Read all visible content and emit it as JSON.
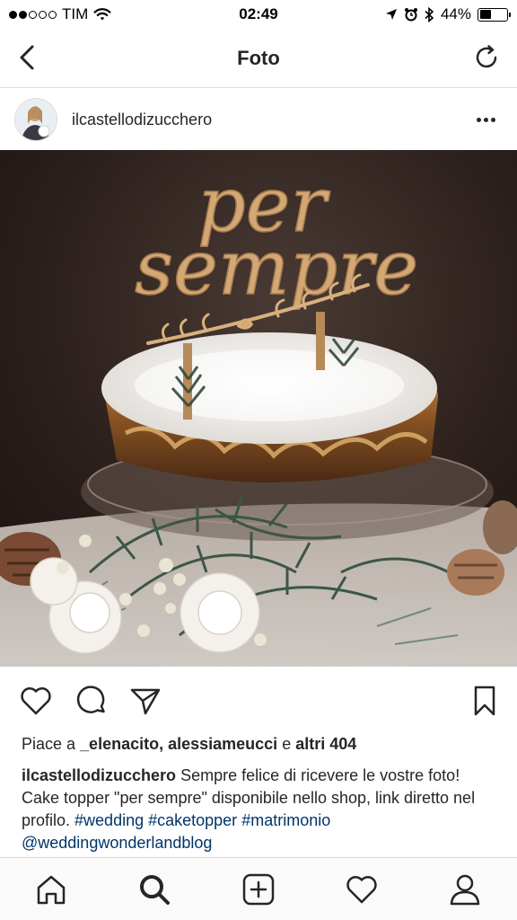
{
  "status_bar": {
    "carrier": "TIM",
    "time": "02:49",
    "battery_percent_label": "44%",
    "battery_level": 0.44,
    "signal_filled": 2,
    "signal_total": 5,
    "icons": [
      "wifi-icon",
      "location-arrow-icon",
      "alarm-clock-icon",
      "bluetooth-icon",
      "battery-icon"
    ]
  },
  "nav": {
    "title": "Foto",
    "icons": [
      "back-chevron-icon",
      "refresh-icon"
    ]
  },
  "post": {
    "username": "ilcastellodizucchero",
    "photo_text": "per sempre",
    "likes": {
      "prefix": "Piace a ",
      "users": "_elenacito, alessiameucci",
      "conjunction": " e ",
      "others": "altri 404"
    },
    "caption": {
      "author": "ilcastellodizucchero",
      "text": " Sempre felice di ricevere le vostre foto! Cake topper \"per sempre\" disponibile nello shop, link diretto nel profilo. ",
      "tags": [
        "#wedding",
        "#caketopper",
        "#matrimonio",
        "@weddingwonderlandblog"
      ]
    },
    "action_icons": [
      "heart-icon",
      "comment-icon",
      "share-icon",
      "bookmark-icon"
    ]
  },
  "colors": {
    "text": "#262626",
    "hashtag": "#003569",
    "divider": "#dbdbdb",
    "tab_bar_bg": "#fafafa"
  },
  "tab_bar": {
    "icons": [
      "home-icon",
      "search-icon",
      "add-post-icon",
      "activity-heart-icon",
      "profile-icon"
    ]
  }
}
